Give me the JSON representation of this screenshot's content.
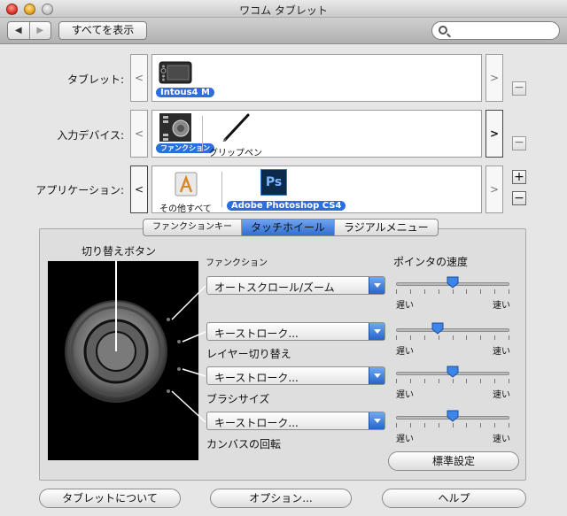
{
  "window": {
    "title": "ワコム タブレット"
  },
  "toolbar": {
    "back": "◀",
    "forward": "▶",
    "show_all": "すべてを表示",
    "search_placeholder": ""
  },
  "rows": {
    "tablet": {
      "label": "タブレット:",
      "item": "Intous4 M",
      "prev": "<",
      "next": ">"
    },
    "input_device": {
      "label": "入力デバイス:",
      "items": [
        "ファンクション",
        "グリップペン"
      ],
      "prev": "<",
      "next": ">"
    },
    "application": {
      "label": "アプリケーション:",
      "items": [
        "その他すべて",
        "Adobe Photoshop CS4"
      ],
      "ps_logo": "Ps",
      "prev": "<",
      "next": ">",
      "add": "+",
      "remove": "−"
    }
  },
  "tabs": [
    {
      "label": "ファンクションキー",
      "active": false
    },
    {
      "label": "タッチホイール",
      "active": true
    },
    {
      "label": "ラジアルメニュー",
      "active": false
    }
  ],
  "panel": {
    "toggle_label": "切り替えボタン",
    "function_heading": "ファンクション",
    "speed_heading": "ポインタの速度",
    "combos": [
      {
        "value": "オートスクロール/ズーム",
        "sub": ""
      },
      {
        "value": "キーストローク...",
        "sub": "レイヤー切り替え"
      },
      {
        "value": "キーストローク...",
        "sub": "ブラシサイズ"
      },
      {
        "value": "キーストローク...",
        "sub": "カンバスの回転"
      }
    ],
    "sliders": [
      {
        "value": 0.5,
        "slow": "遅い",
        "fast": "速い"
      },
      {
        "value": 0.35,
        "slow": "遅い",
        "fast": "速い"
      },
      {
        "value": 0.5,
        "slow": "遅い",
        "fast": "速い"
      },
      {
        "value": 0.5,
        "slow": "遅い",
        "fast": "速い"
      }
    ],
    "default_button": "標準設定"
  },
  "bottom": {
    "about": "タブレットについて",
    "options": "オプション...",
    "help": "ヘルプ"
  },
  "colors": {
    "selection_blue": "#2a6fdb",
    "accent_blue": "#2f6fd0"
  }
}
